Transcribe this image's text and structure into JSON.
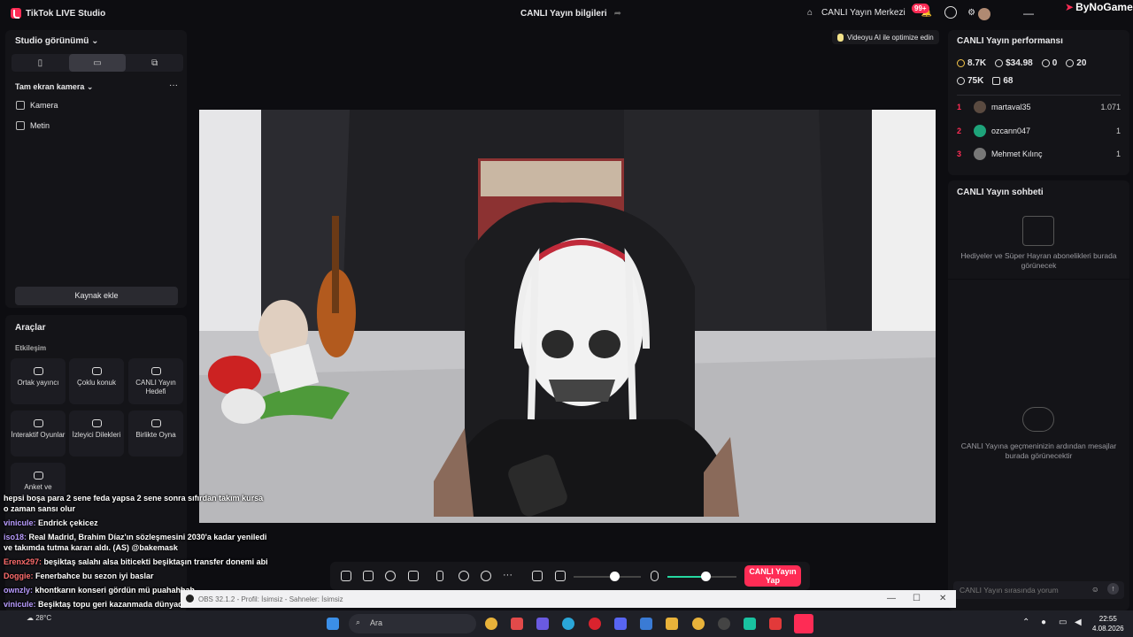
{
  "app": {
    "title": "TikTok LIVE Studio",
    "center_title": "CANLI Yayın bilgileri",
    "live_center": "CANLI Yayın Merkezi",
    "notif_badge": "99+",
    "watermark": "ByNoGame"
  },
  "left": {
    "studio_view": "Studio görünümü",
    "full_camera": "Tam ekran kamera",
    "sources": [
      "Kamera",
      "Metin"
    ],
    "add_source": "Kaynak ekle",
    "tools_title": "Araçlar",
    "tools_section": "Etkileşim",
    "tools": [
      "Ortak yayıncı",
      "Çoklu konuk",
      "CANLI Yayın Hedefi",
      "İnteraktif Oyunlar",
      "İzleyici Dilekleri",
      "Birlikte Oyna",
      "Anket ve"
    ]
  },
  "preview": {
    "optimize": "Videoyu AI ile optimize edin"
  },
  "controls": {
    "go_live": "CANLI Yayın Yap",
    "volume_level": 0.6,
    "mic_level": 0.55
  },
  "right": {
    "perf_title": "CANLI Yayın performansı",
    "stats": [
      {
        "icon": "diamond-icon",
        "value": "8.7K"
      },
      {
        "icon": "dollar-icon",
        "value": "$34.98"
      },
      {
        "icon": "viewers-icon",
        "value": "0"
      },
      {
        "icon": "followers-icon",
        "value": "20"
      }
    ],
    "stats2": [
      {
        "icon": "heart-icon",
        "value": "75K"
      },
      {
        "icon": "gift-icon",
        "value": "68"
      }
    ],
    "top": [
      {
        "rank": "1",
        "name": "martaval35",
        "value": "1.071",
        "color": "#5a4a40"
      },
      {
        "rank": "2",
        "name": "ozcann047",
        "value": "1",
        "color": "#1ea37a"
      },
      {
        "rank": "3",
        "name": "Mehmet Kılınç",
        "value": "1",
        "color": "#777"
      }
    ],
    "chat_title": "CANLI Yayın sohbeti",
    "gift_empty": "Hediyeler ve Süper Hayran abonelikleri burada görünecek",
    "chat_empty": "CANLI Yayına geçmeninizin ardından mesajlar burada görünecektir",
    "chat_placeholder": "CANLI Yayın sırasında yorum"
  },
  "overlay_chat": [
    {
      "user": "",
      "text": "hepsi boşa para 2 sene feda yapsa 2 sene sonra sıfırdan takım kursa o zaman sansı olur"
    },
    {
      "user": "vinicule:",
      "text": "Endrick çekicez"
    },
    {
      "user": "iso18:",
      "text": "Real Madrid, Brahim Díaz'ın sözleşmesini 2030'a kadar yeniledi ve takımda tutma kararı aldı. (AS) @bakemask"
    },
    {
      "user": "Erenx297:",
      "text": "beşiktaş salahı alsa biticekti beşiktaşın transfer donemi abi"
    },
    {
      "user": "Doggie:",
      "text": "Fenerbahce bu sezon iyi baslar"
    },
    {
      "user": "ownzly:",
      "text": "khontkarın konseri gördün mü puahahhah"
    },
    {
      "user": "vinicule:",
      "text": "Beşiktaş topu geri kazanmada dünyada birinci sırada"
    }
  ],
  "obs": {
    "title": "OBS 32.1.2 - Profil: İsimsiz - Sahneler: İsimsiz"
  },
  "taskbar": {
    "search": "Ara",
    "time": "22:55",
    "date": "4.08.2026",
    "temp": "28°C"
  }
}
